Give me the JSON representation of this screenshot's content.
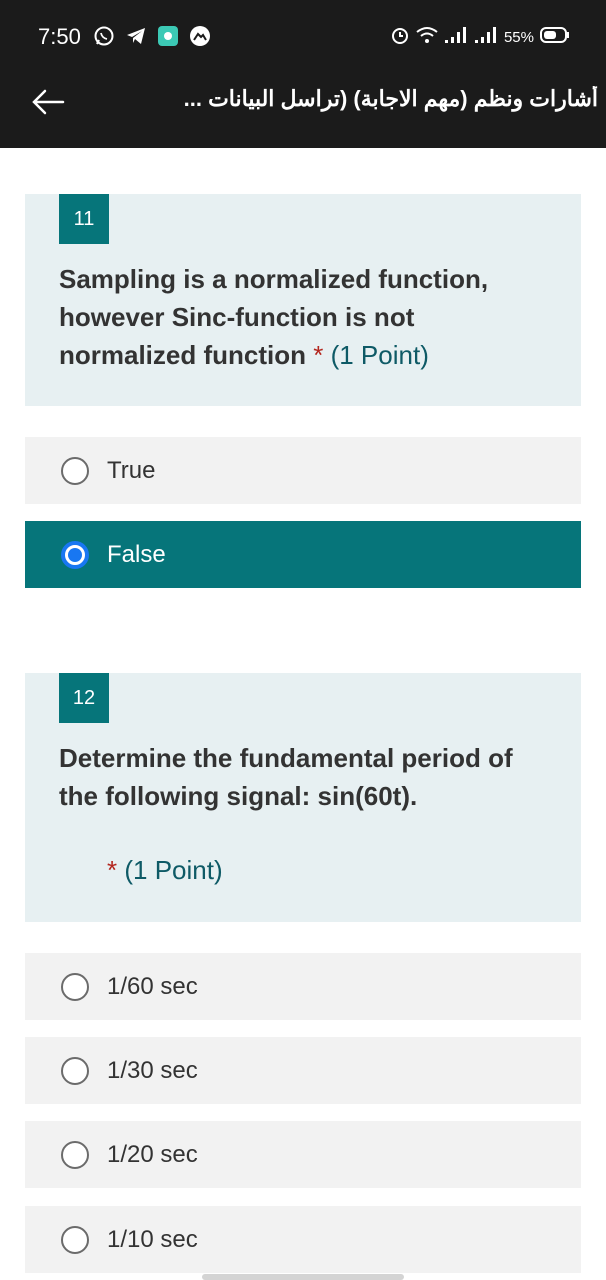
{
  "status_bar": {
    "time": "7:50",
    "battery": "55%",
    "icons": [
      "whatsapp-icon",
      "telegram-icon",
      "app-icon",
      "mountain-icon",
      "alarm-icon",
      "wifi-icon",
      "signal-icon",
      "signal-icon-2",
      "battery-icon"
    ]
  },
  "app_bar": {
    "title": "أشارات ونظم (مهم الاجابة) (تراسل البيانات ...",
    "back_icon": "arrow-left-icon"
  },
  "questions": [
    {
      "number": "11",
      "text": "Sampling is a normalized function, however Sinc-function is not normalized function",
      "required_mark": "*",
      "points": "(1 Point)",
      "options": [
        {
          "label": "True",
          "selected": false
        },
        {
          "label": "False",
          "selected": true
        }
      ]
    },
    {
      "number": "12",
      "text": "Determine the fundamental period of the following signal: sin(60t).",
      "required_mark": "*",
      "points": "(1 Point)",
      "options": [
        {
          "label": "1/60 sec",
          "selected": false
        },
        {
          "label": "1/30 sec",
          "selected": false
        },
        {
          "label": "1/20 sec",
          "selected": false
        },
        {
          "label": "1/10 sec",
          "selected": false
        }
      ]
    }
  ],
  "colors": {
    "accent": "#06757a",
    "selected_radio": "#1877f2",
    "question_bg": "#e7f0f2",
    "option_bg": "#f2f2f2",
    "required": "#b3261e"
  }
}
